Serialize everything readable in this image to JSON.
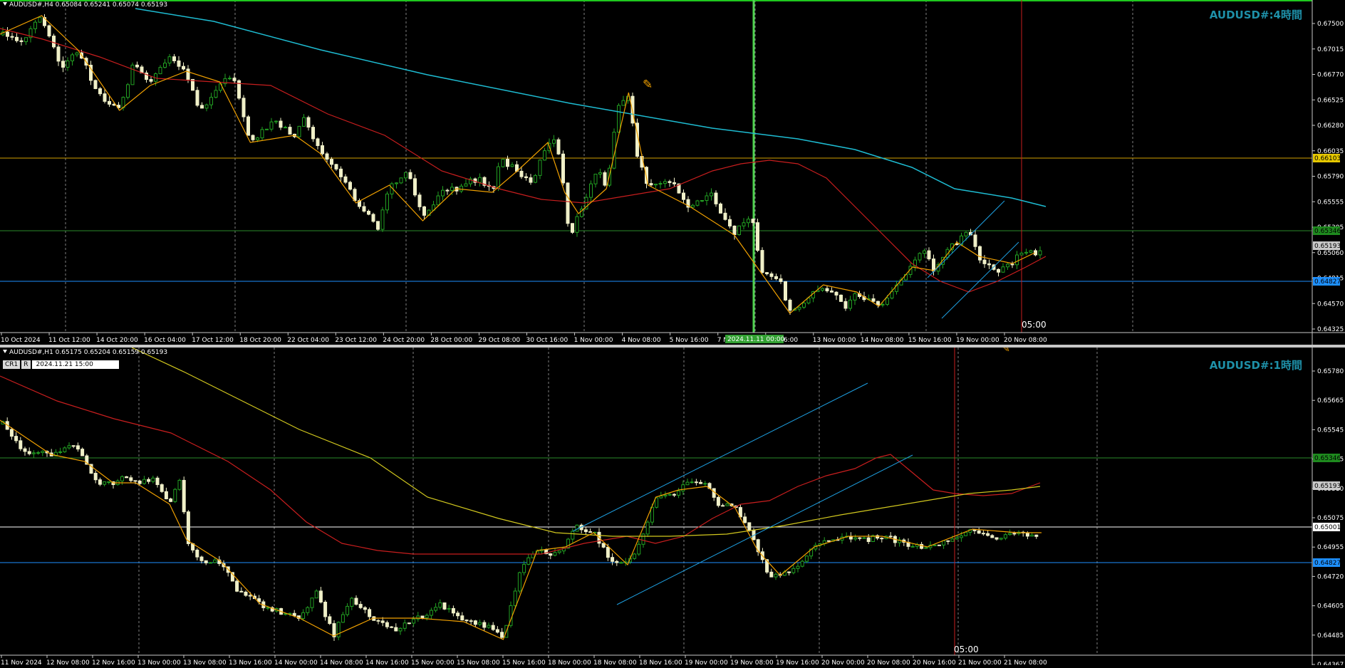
{
  "top": {
    "info": "AUDUSD#,H4  0.65084 0.65241 0.65074 0.65193",
    "title": "AUDUSD#:4時間",
    "price_labels": [
      "0.67500",
      "0.67015",
      "0.66770",
      "0.66525",
      "0.66280",
      "0.66035",
      "0.65790",
      "0.65555",
      "0.65305",
      "0.65060",
      "0.64815",
      "0.64570",
      "0.64325"
    ],
    "tags": {
      "yellow": "0.66103",
      "green": "0.65346",
      "current": "0.65193",
      "blue": "0.64827"
    },
    "time_labels": [
      "10 Oct 2024",
      "11 Oct 12:00",
      "14 Oct 20:00",
      "16 Oct 04:00",
      "17 Oct 12:00",
      "18 Oct 20:00",
      "22 Oct 04:00",
      "23 Oct 12:00",
      "24 Oct 20:00",
      "28 Oct 00:00",
      "29 Oct 08:00",
      "30 Oct 16:00",
      "1 Nov 00:00",
      "4 Nov 08:00",
      "5 Nov 16:00",
      "7 Nov 00:00",
      "Nov 16:00",
      "13 Nov 00:00",
      "14 Nov 08:00",
      "15 Nov 16:00",
      "19 Nov 00:00",
      "20 Nov 08:00"
    ],
    "crosshair_time": "2024.11.11 00:00",
    "cursor_label": "05:00"
  },
  "bottom": {
    "info": "AUDUSD#,H1  0.65175 0.65204 0.65159 0.65193",
    "title": "AUDUSD#:1時間",
    "cr_label": "CR1",
    "r_label": "R",
    "date_value": "2024.11.21 15:00",
    "price_labels": [
      "0.65780",
      "0.65665",
      "0.65545",
      "0.65425",
      "0.65310",
      "0.65075",
      "0.64955",
      "0.64720",
      "0.64605",
      "0.64485",
      "0.64367"
    ],
    "tags": {
      "green": "0.65346",
      "current": "0.65193",
      "white": "0.65001",
      "blue": "0.64827"
    },
    "time_labels": [
      "11 Nov 2024",
      "12 Nov 08:00",
      "12 Nov 16:00",
      "13 Nov 00:00",
      "13 Nov 08:00",
      "13 Nov 16:00",
      "14 Nov 00:00",
      "14 Nov 08:00",
      "14 Nov 16:00",
      "15 Nov 00:00",
      "15 Nov 08:00",
      "15 Nov 16:00",
      "18 Nov 00:00",
      "18 Nov 08:00",
      "18 Nov 16:00",
      "19 Nov 00:00",
      "19 Nov 08:00",
      "19 Nov 16:00",
      "20 Nov 00:00",
      "20 Nov 08:00",
      "20 Nov 16:00",
      "21 Nov 00:00",
      "21 Nov 08:00"
    ],
    "cursor_label": "05:00"
  },
  "colors": {
    "bull": "#22a022",
    "bear": "#f0f0c8",
    "ma_red": "#c81e1e",
    "ma_cyan": "#1ebcd2",
    "ma_yellow": "#d2c81e",
    "zigzag": "#f0a000",
    "hline_yellow": "#d2a000",
    "hline_green": "#2a8a2a",
    "hline_blue": "#1e90ff",
    "channel": "#1e9fe0",
    "grid": "#808080"
  }
}
